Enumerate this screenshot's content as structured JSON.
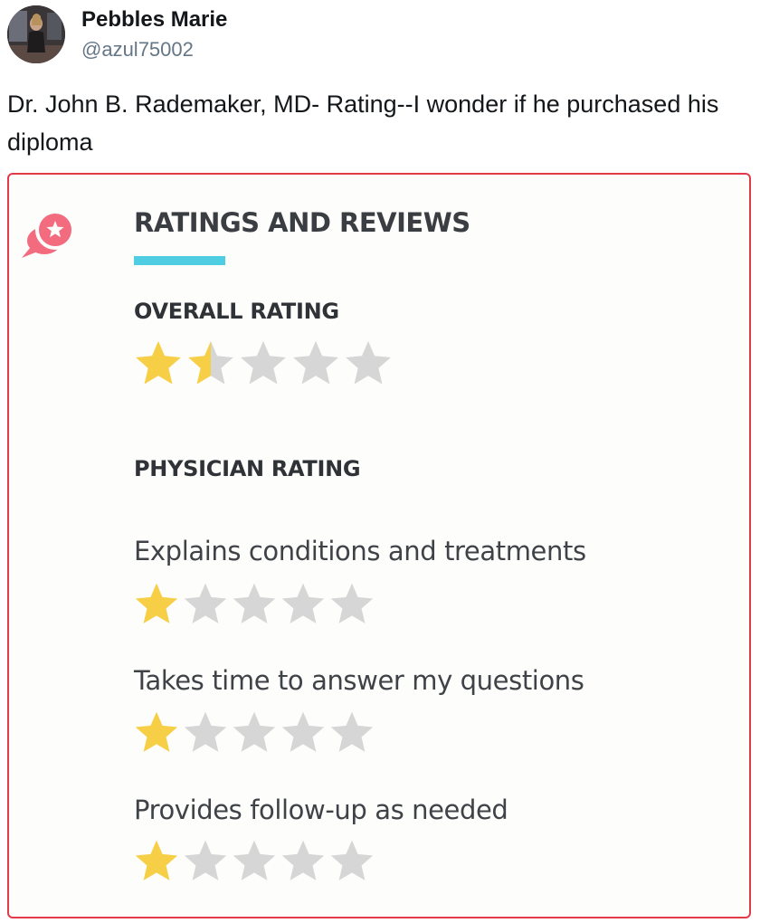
{
  "tweet": {
    "display_name": "Pebbles Marie",
    "handle": "@azul75002",
    "text": "Dr. John B. Rademaker, MD- Rating--I wonder if he purchased his diploma"
  },
  "card": {
    "title": "RATINGS AND REVIEWS",
    "icon": "review-bubble-star-icon",
    "accent_color": "#4fcde2",
    "icon_color": "#f26b7e",
    "star_filled_color": "#f7cf47",
    "star_empty_color": "#d6d6d6",
    "overall": {
      "label": "OVERALL RATING",
      "rating": 1.5,
      "max": 5
    },
    "physician": {
      "label": "PHYSICIAN RATING",
      "criteria": [
        {
          "label": "Explains conditions and treatments",
          "rating": 1,
          "max": 5
        },
        {
          "label": "Takes time to answer my questions",
          "rating": 1,
          "max": 5
        },
        {
          "label": "Provides follow-up as needed",
          "rating": 1,
          "max": 5
        }
      ]
    }
  }
}
